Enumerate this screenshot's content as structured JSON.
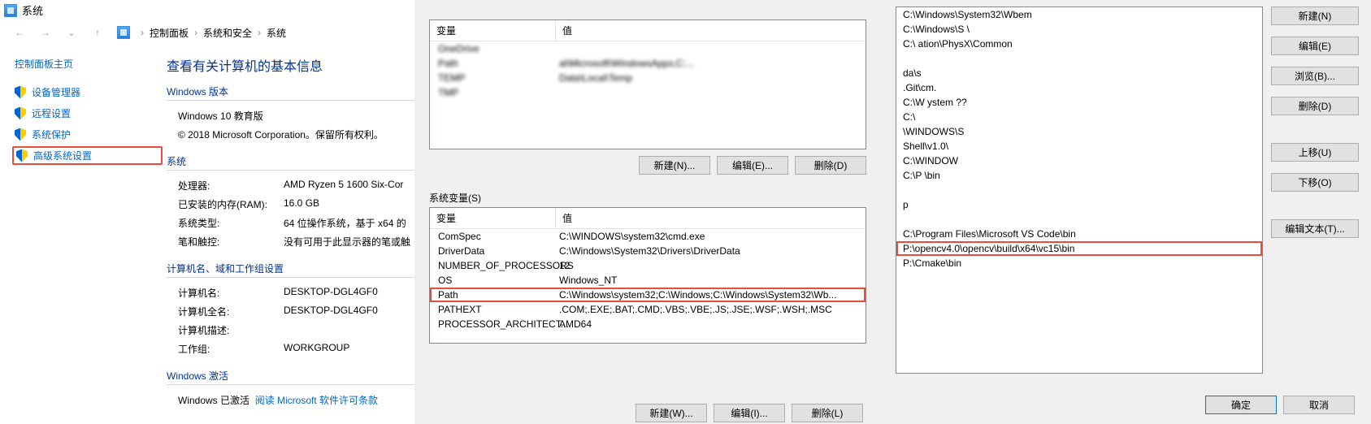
{
  "window": {
    "title": "系统",
    "breadcrumbs": [
      "控制面板",
      "系统和安全",
      "系统"
    ]
  },
  "sidebar": {
    "home": "控制面板主页",
    "items": [
      {
        "label": "设备管理器"
      },
      {
        "label": "远程设置"
      },
      {
        "label": "系统保护"
      },
      {
        "label": "高级系统设置"
      }
    ]
  },
  "sys_main": {
    "heading": "查看有关计算机的基本信息",
    "win_ver_label": "Windows 版本",
    "win_ver": "Windows 10 教育版",
    "copyright": "© 2018 Microsoft Corporation。保留所有权利。",
    "system_label": "系统",
    "rows": [
      {
        "k": "处理器:",
        "v": "AMD Ryzen 5 1600 Six-Cor"
      },
      {
        "k": "已安装的内存(RAM):",
        "v": "16.0 GB"
      },
      {
        "k": "系统类型:",
        "v": "64 位操作系统，基于 x64 的"
      },
      {
        "k": "笔和触控:",
        "v": "没有可用于此显示器的笔或触"
      }
    ],
    "cname_label": "计算机名、域和工作组设置",
    "cname_rows": [
      {
        "k": "计算机名:",
        "v": "DESKTOP-DGL4GF0"
      },
      {
        "k": "计算机全名:",
        "v": "DESKTOP-DGL4GF0"
      },
      {
        "k": "计算机描述:",
        "v": ""
      },
      {
        "k": "工作组:",
        "v": "WORKGROUP"
      }
    ],
    "activation_label": "Windows 激活",
    "activation_text": "Windows 已激活",
    "activation_link": "阅读 Microsoft 软件许可条款"
  },
  "env": {
    "user_vars_header_name": "变量",
    "user_vars_header_val": "值",
    "user_vars": [
      {
        "name": "OneDrive",
        "value": ""
      },
      {
        "name": "Path",
        "value": "al\\Microsoft\\WindowsApps;C:..."
      },
      {
        "name": "TEMP",
        "value": "Data\\Local\\Temp"
      },
      {
        "name": "TMP",
        "value": ""
      }
    ],
    "sys_vars_label": "系统变量(S)",
    "sys_vars": [
      {
        "name": "ComSpec",
        "value": "C:\\WINDOWS\\system32\\cmd.exe"
      },
      {
        "name": "DriverData",
        "value": "C:\\Windows\\System32\\Drivers\\DriverData"
      },
      {
        "name": "NUMBER_OF_PROCESSORS",
        "value": "12"
      },
      {
        "name": "OS",
        "value": "Windows_NT"
      },
      {
        "name": "Path",
        "value": "C:\\Windows\\system32;C:\\Windows;C:\\Windows\\System32\\Wb..."
      },
      {
        "name": "PATHEXT",
        "value": ".COM;.EXE;.BAT;.CMD;.VBS;.VBE;.JS;.JSE;.WSF;.WSH;.MSC"
      },
      {
        "name": "PROCESSOR_ARCHITECT...",
        "value": "AMD64"
      }
    ],
    "buttons": {
      "new": "新建(N)...",
      "edit": "编辑(E)...",
      "delete": "删除(D)"
    },
    "buttons2": {
      "new": "新建(W)...",
      "edit": "编辑(I)...",
      "delete": "删除(L)"
    }
  },
  "path_editor": {
    "items": [
      "C:\\Windows\\System32\\Wbem",
      "C:\\Windows\\S                       \\",
      "C:\\                                                              ation\\PhysX\\Common",
      "",
      "              da\\s",
      "       .Git\\cm.",
      " C:\\W                ystem ??",
      " C:\\",
      "  \\WINDOWS\\S",
      "                                               Shell\\v1.0\\",
      "C:\\WINDOW",
      "C:\\P                                           \\bin",
      "",
      "p",
      "",
      "C:\\Program Files\\Microsoft VS Code\\bin",
      "P:\\opencv4.0\\opencv\\build\\x64\\vc15\\bin",
      "P:\\Cmake\\bin"
    ],
    "buttons": {
      "new": "新建(N)",
      "edit": "编辑(E)",
      "browse": "浏览(B)...",
      "delete": "删除(D)",
      "up": "上移(U)",
      "down": "下移(O)",
      "edit_text": "编辑文本(T)..."
    },
    "ok": "确定",
    "cancel": "取消"
  }
}
